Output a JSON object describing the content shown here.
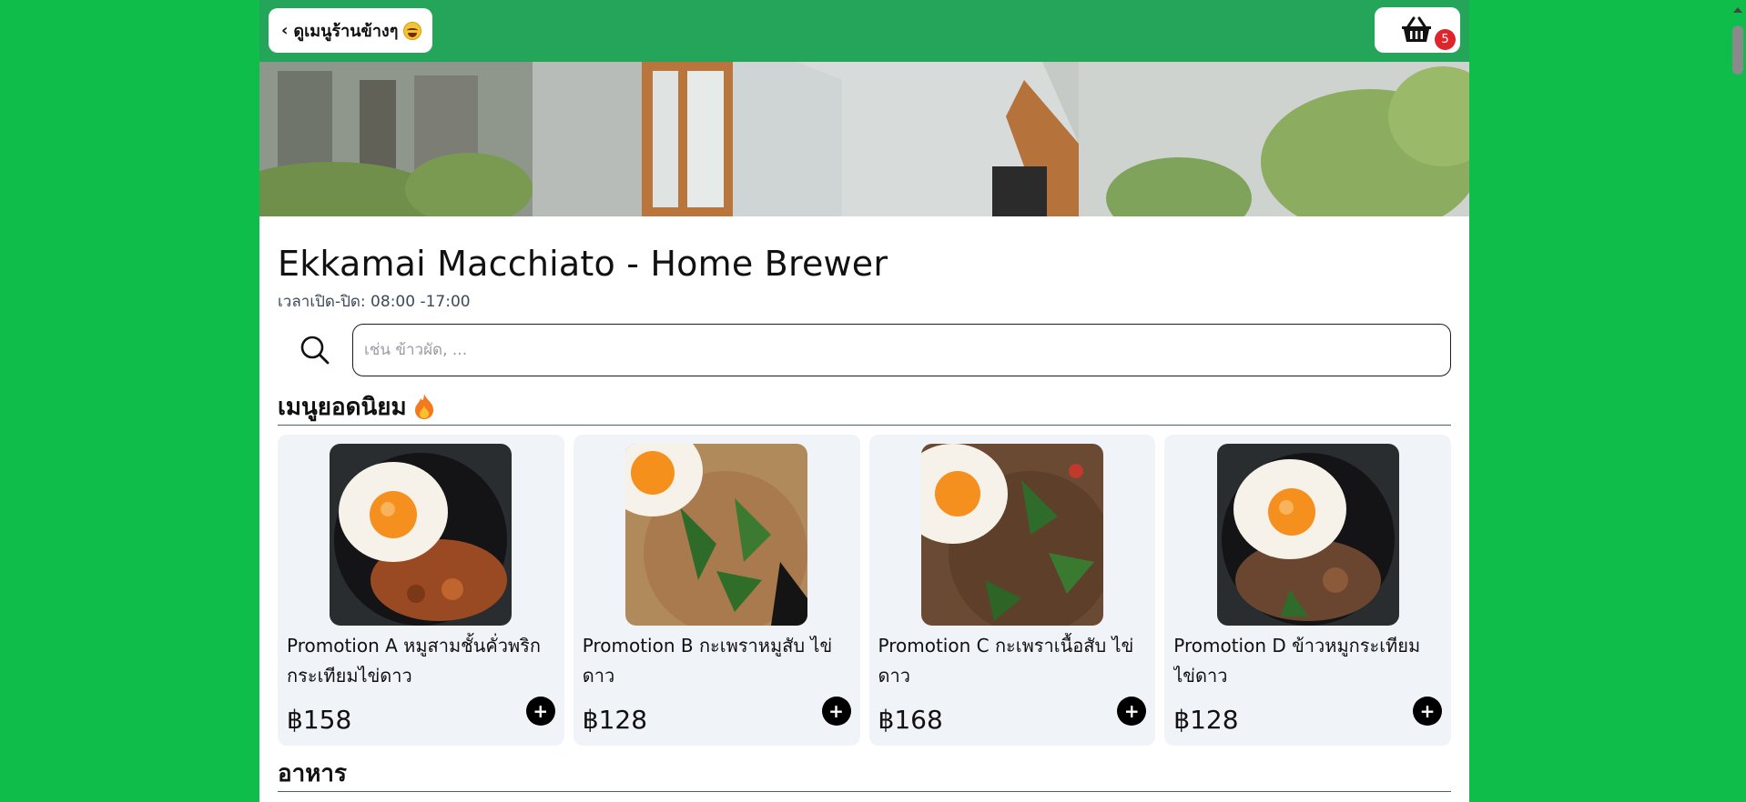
{
  "header": {
    "back_label": "ดูเมนูร้านข้างๆ",
    "cart_count": "5"
  },
  "store": {
    "name": "Ekkamai Macchiato - Home Brewer",
    "hours": "เวลาเปิด-ปิด: 08:00 -17:00"
  },
  "search": {
    "placeholder": "เช่น ข้าวผัด, ..."
  },
  "popular": {
    "title": "เมนูยอดนิยม",
    "items": [
      {
        "name": "Promotion A หมูสามชั้นคั่วพริกกระเทียมไข่ดาว",
        "price": "฿158",
        "add": "+"
      },
      {
        "name": "Promotion B กะเพราหมูสับ ไข่ดาว",
        "price": "฿128",
        "add": "+"
      },
      {
        "name": "Promotion C กะเพราเนื้อสับ ไข่ดาว",
        "price": "฿168",
        "add": "+"
      },
      {
        "name": "Promotion D ข้าวหมูกระเทียม ไข่ดาว",
        "price": "฿128",
        "add": "+"
      }
    ]
  },
  "food": {
    "title": "อาหาร"
  },
  "colors": {
    "page_bg": "#0fbd4b",
    "topbar": "#25a55a",
    "badge": "#e0242c",
    "card_bg": "#f0f3f8"
  }
}
